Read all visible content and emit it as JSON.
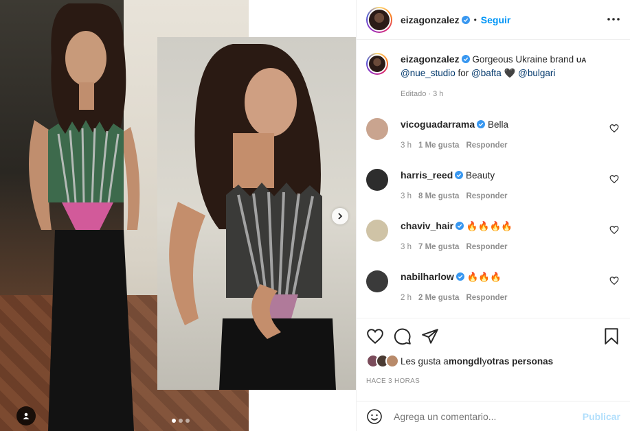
{
  "post": {
    "author": "eizagonzalez",
    "follow_label": "Seguir",
    "separator": "•",
    "caption_text": "Gorgeous Ukraine brand",
    "caption_flag": "UA",
    "caption_mention1": "@nue_studio",
    "caption_for": " for ",
    "caption_mention2": "@bafta",
    "caption_heart": "🖤",
    "caption_mention3": "@bulgari",
    "caption_meta": "Editado · 3 h"
  },
  "comments": [
    {
      "user": "vicoguadarrama",
      "text": "Bella",
      "time": "3 h",
      "likes": "1 Me gusta",
      "reply": "Responder",
      "avatar_color": "#c9a48f"
    },
    {
      "user": "harris_reed",
      "text": "Beauty",
      "time": "3 h",
      "likes": "8 Me gusta",
      "reply": "Responder",
      "avatar_color": "#2d2d2d"
    },
    {
      "user": "chaviv_hair",
      "text": "🔥🔥🔥🔥",
      "time": "3 h",
      "likes": "7 Me gusta",
      "reply": "Responder",
      "avatar_color": "#cfc3a6"
    },
    {
      "user": "nabilharlow",
      "text": "🔥🔥🔥",
      "time": "2 h",
      "likes": "2 Me gusta",
      "reply": "Responder",
      "avatar_color": "#3a3a3a"
    }
  ],
  "likes": {
    "prefix": "Les gusta a ",
    "user": "mongdl",
    "mid": " y ",
    "others": "otras personas"
  },
  "time_ago": "HACE 3 HORAS",
  "comment_box": {
    "placeholder": "Agrega un comentario...",
    "post_label": "Publicar"
  },
  "colors": {
    "accent": "#0095f6",
    "verified": "#3897f0",
    "mention": "#00376b",
    "muted": "#8e8e8e"
  },
  "icons": {
    "more": "more-horizontal-icon",
    "heart": "heart-icon",
    "comment": "comment-icon",
    "share": "paper-plane-icon",
    "save": "bookmark-icon",
    "emoji": "smiley-icon",
    "next": "chevron-right-icon",
    "tag": "user-tag-icon"
  }
}
